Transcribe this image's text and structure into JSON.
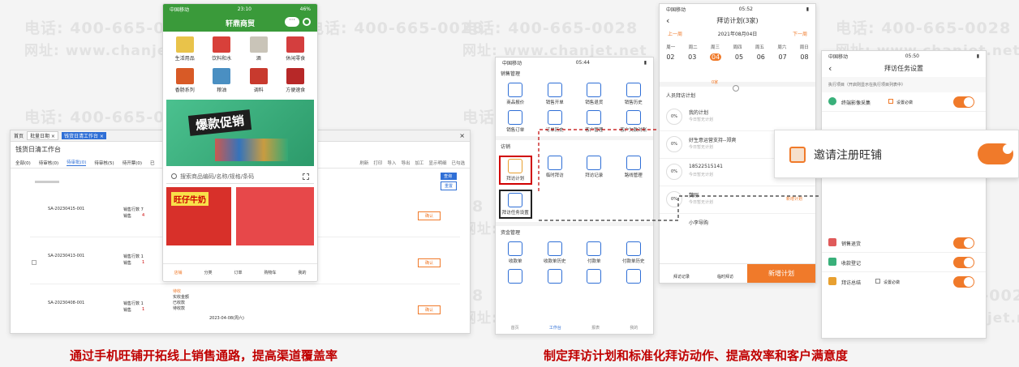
{
  "watermark": {
    "phone": "电话: 400-665-0028",
    "site": "网址: www.chanjet.net"
  },
  "captions": {
    "left": "通过手机旺铺开拓线上销售通路，提高渠道覆盖率",
    "right": "制定拜访计划和标准化拜访动作、提高效率和客户满意度"
  },
  "desktop": {
    "tabs": [
      "首页",
      "批量日期 ×",
      "钱货日清工作台 ×"
    ],
    "title": "钱货日清工作台",
    "subtabs": [
      "全部(0)",
      "待审核(0)",
      "待审批(0)",
      "待审核(5)",
      "待开票(0)",
      "已"
    ],
    "toolbar": [
      "刷新",
      "打印",
      "导入",
      "导出",
      "加工",
      "显示明细",
      "已勾选"
    ],
    "search_label": "查询",
    "reset_label": "重置",
    "rows": [
      {
        "no": "SA-20230415-001",
        "qty_label": "销售行数 7",
        "amount_label": "销售",
        "amount": "4"
      },
      {
        "no": "SA-20230413-001",
        "qty_label": "销售行数 1",
        "amount_label": "销售",
        "amount": "1"
      },
      {
        "no": "SA-20230408-001",
        "qty_label": "销售行数 1",
        "amount_label": "销售",
        "amount": "1"
      }
    ],
    "row_action": "确认",
    "footer": {
      "status": "待收",
      "c1": "实收金额",
      "c2": "已收款",
      "c3": "待收款",
      "date": "2023-04-08(周六)"
    }
  },
  "shop": {
    "status_left": "中国移动",
    "time": "23:10",
    "battery": "46%",
    "title": "轩鼎商贸",
    "categories": [
      "生活用品",
      "饮料和水",
      "酒",
      "休闲零食",
      "香肠系列",
      "粮油",
      "调料",
      "方便速食"
    ],
    "banner": "爆款促销",
    "search_placeholder": "搜索商品编码/名称/规格/条码",
    "promo": "旺仔牛奶",
    "nav": [
      "店铺",
      "分类",
      "订单",
      "购物车",
      "我的"
    ]
  },
  "apps": {
    "status_left": "中国移动",
    "time": "05:44",
    "sections": [
      {
        "title": "销售管理",
        "items": [
          "商品报价",
          "销售开单",
          "销售退货",
          "销售历史",
          "销售订单",
          "订单历史",
          "客户管理",
          "客户欠款对账"
        ]
      },
      {
        "title": "访销",
        "items": [
          "拜访计划",
          "临时拜访",
          "拜访记录",
          "路线管理",
          "拜访任务设置"
        ]
      },
      {
        "title": "资金管理",
        "items": [
          "收款单",
          "收款单历史",
          "付款单",
          "付款单历史",
          "",
          "",
          "",
          ""
        ]
      }
    ],
    "nav": [
      "首页",
      "工作台",
      "报表",
      "我的"
    ]
  },
  "plan": {
    "status_left": "中国移动",
    "time": "05:52",
    "title": "拜访计划(3家)",
    "prev": "上一周",
    "date": "2021年08月04日",
    "next": "下一周",
    "weekdays": [
      "周一",
      "周二",
      "周三",
      "周四",
      "周五",
      "周六",
      "周日"
    ],
    "days": [
      "02",
      "03",
      "04",
      "05",
      "06",
      "07",
      "08"
    ],
    "status_label": "0家",
    "section": "人员拜访计划",
    "items": [
      {
        "pct": "0%",
        "name": "我的计划",
        "sub": "今日暂无计划"
      },
      {
        "pct": "0%",
        "name": "好生意运营支持--郑爽",
        "sub": "今日暂无计划"
      },
      {
        "pct": "0%",
        "name": "18522515141",
        "sub": "今日暂无计划"
      },
      {
        "pct": "0%",
        "name": "魏刚",
        "sub": "今日暂无计划"
      },
      {
        "pct": "",
        "name": "小李导购",
        "sub": ""
      }
    ],
    "link_label": "新增计划",
    "bottom": [
      "拜访记录",
      "临时拜访"
    ],
    "add": "新增计划"
  },
  "task": {
    "status_left": "中国移动",
    "time": "05:50",
    "title": "拜访任务设置",
    "hint": "执行项目（开启则显示在执行项目列表中）",
    "items": [
      {
        "label": "终端影像采集",
        "extra": "设置必做"
      },
      {
        "label": "销售退货",
        "extra": ""
      },
      {
        "label": "收款登记",
        "extra": ""
      },
      {
        "label": "拜访总结",
        "extra": "设置必做"
      }
    ],
    "popup": "邀请注册旺铺"
  },
  "colors": {
    "accent": "#f07a2a",
    "caption": "#c00000",
    "shop_green": "#3a9a3a",
    "link_blue": "#2f6fd6"
  }
}
